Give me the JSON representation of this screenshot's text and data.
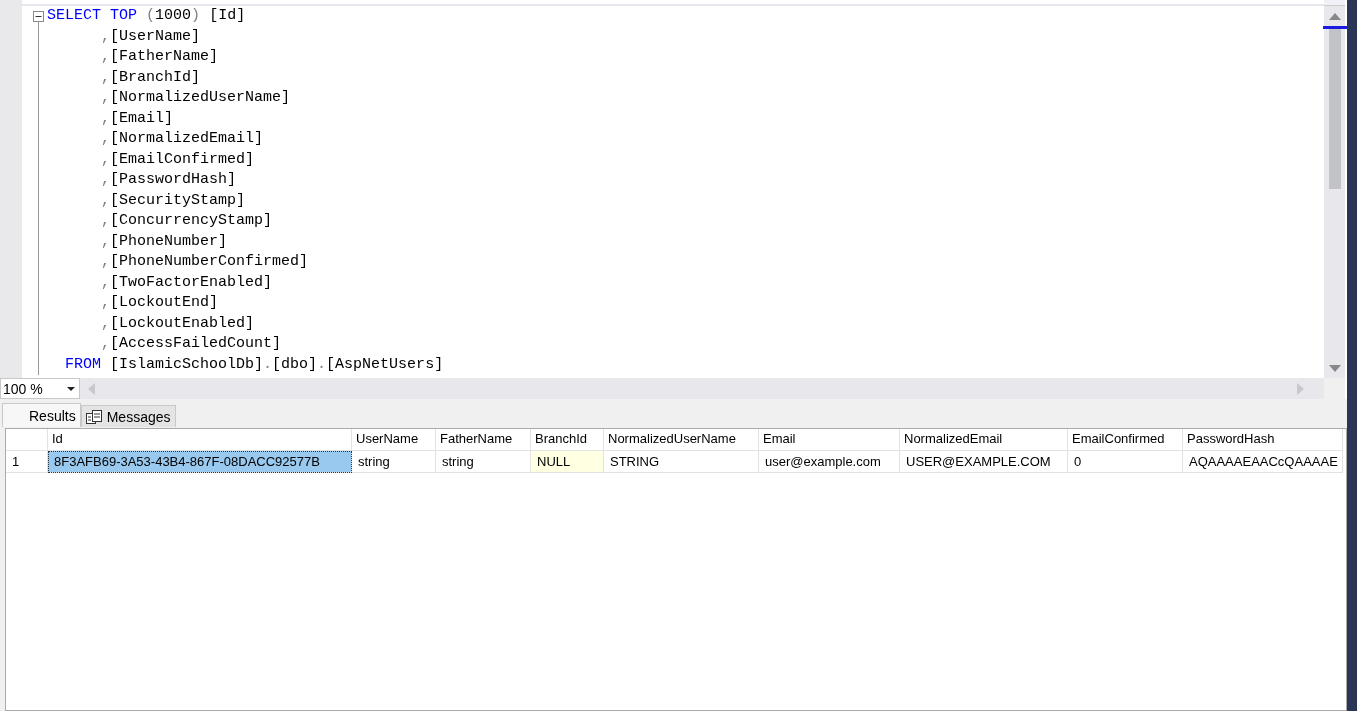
{
  "editor": {
    "lines": [
      {
        "kind": "select",
        "tokens": [
          {
            "t": "SELECT",
            "kind": "keyword"
          },
          {
            "t": "TOP",
            "kind": "keyword"
          },
          {
            "t": "(",
            "kind": "open"
          },
          {
            "t": "1000",
            "kind": "plain"
          },
          {
            "t": ")",
            "kind": "close"
          },
          {
            "t": "[Id]",
            "kind": "plain"
          }
        ]
      },
      {
        "kind": "column",
        "tokens": [
          {
            "t": ",",
            "kind": "sep"
          },
          {
            "t": "[UserName]",
            "kind": "plain"
          }
        ]
      },
      {
        "kind": "column",
        "tokens": [
          {
            "t": ",",
            "kind": "sep"
          },
          {
            "t": "[FatherName]",
            "kind": "plain"
          }
        ]
      },
      {
        "kind": "column",
        "tokens": [
          {
            "t": ",",
            "kind": "sep"
          },
          {
            "t": "[BranchId]",
            "kind": "plain"
          }
        ]
      },
      {
        "kind": "column",
        "tokens": [
          {
            "t": ",",
            "kind": "sep"
          },
          {
            "t": "[NormalizedUserName]",
            "kind": "plain"
          }
        ]
      },
      {
        "kind": "column",
        "tokens": [
          {
            "t": ",",
            "kind": "sep"
          },
          {
            "t": "[Email]",
            "kind": "plain"
          }
        ]
      },
      {
        "kind": "column",
        "tokens": [
          {
            "t": ",",
            "kind": "sep"
          },
          {
            "t": "[NormalizedEmail]",
            "kind": "plain"
          }
        ]
      },
      {
        "kind": "column",
        "tokens": [
          {
            "t": ",",
            "kind": "sep"
          },
          {
            "t": "[EmailConfirmed]",
            "kind": "plain"
          }
        ]
      },
      {
        "kind": "column",
        "tokens": [
          {
            "t": ",",
            "kind": "sep"
          },
          {
            "t": "[PasswordHash]",
            "kind": "plain"
          }
        ]
      },
      {
        "kind": "column",
        "tokens": [
          {
            "t": ",",
            "kind": "sep"
          },
          {
            "t": "[SecurityStamp]",
            "kind": "plain"
          }
        ]
      },
      {
        "kind": "column",
        "tokens": [
          {
            "t": ",",
            "kind": "sep"
          },
          {
            "t": "[ConcurrencyStamp]",
            "kind": "plain"
          }
        ]
      },
      {
        "kind": "column",
        "tokens": [
          {
            "t": ",",
            "kind": "sep"
          },
          {
            "t": "[PhoneNumber]",
            "kind": "plain"
          }
        ]
      },
      {
        "kind": "column",
        "tokens": [
          {
            "t": ",",
            "kind": "sep"
          },
          {
            "t": "[PhoneNumberConfirmed]",
            "kind": "plain"
          }
        ]
      },
      {
        "kind": "column",
        "tokens": [
          {
            "t": ",",
            "kind": "sep"
          },
          {
            "t": "[TwoFactorEnabled]",
            "kind": "plain"
          }
        ]
      },
      {
        "kind": "column",
        "tokens": [
          {
            "t": ",",
            "kind": "sep"
          },
          {
            "t": "[LockoutEnd]",
            "kind": "plain"
          }
        ]
      },
      {
        "kind": "column",
        "tokens": [
          {
            "t": ",",
            "kind": "sep"
          },
          {
            "t": "[LockoutEnabled]",
            "kind": "plain"
          }
        ]
      },
      {
        "kind": "column",
        "tokens": [
          {
            "t": ",",
            "kind": "sep"
          },
          {
            "t": "[AccessFailedCount]",
            "kind": "plain"
          }
        ]
      },
      {
        "kind": "from",
        "tokens": [
          {
            "t": "FROM",
            "kind": "keyword"
          },
          {
            "t": "[IslamicSchoolDb]",
            "kind": "plain"
          },
          {
            "t": ".",
            "kind": "sep"
          },
          {
            "t": "[dbo]",
            "kind": "plain"
          },
          {
            "t": ".",
            "kind": "sep"
          },
          {
            "t": "[AspNetUsers]",
            "kind": "plain"
          }
        ]
      }
    ]
  },
  "zoom": {
    "value": "100 %"
  },
  "tabs": [
    {
      "label": "Results",
      "selected": true,
      "kind": "grid"
    },
    {
      "label": "Messages",
      "selected": false,
      "kind": "messages"
    }
  ],
  "grid": {
    "columns": [
      "Id",
      "UserName",
      "FatherName",
      "BranchId",
      "NormalizedUserName",
      "Email",
      "NormalizedEmail",
      "EmailConfirmed",
      "PasswordHash"
    ],
    "rows": [
      {
        "number": "1",
        "cells": [
          {
            "text": "8F3AFB69-3A53-43B4-867F-08DACC92577B",
            "kind": "value",
            "selected": true
          },
          {
            "text": "string",
            "kind": "value",
            "selected": false
          },
          {
            "text": "string",
            "kind": "value",
            "selected": false
          },
          {
            "text": "NULL",
            "kind": "null",
            "selected": false
          },
          {
            "text": "STRING",
            "kind": "value",
            "selected": false
          },
          {
            "text": "user@example.com",
            "kind": "value",
            "selected": false
          },
          {
            "text": "USER@EXAMPLE.COM",
            "kind": "value",
            "selected": false
          },
          {
            "text": "0",
            "kind": "value",
            "selected": false
          },
          {
            "text": "AQAAAAEAACcQAAAAE",
            "kind": "value",
            "selected": false
          }
        ]
      }
    ]
  }
}
